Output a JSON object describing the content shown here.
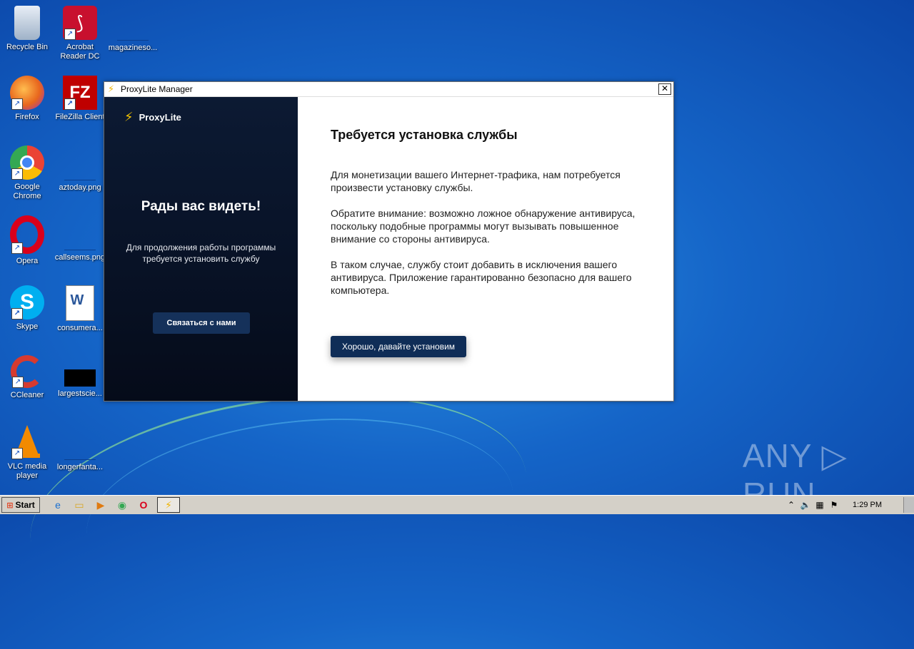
{
  "desktop": {
    "icons": [
      {
        "label": "Recycle Bin",
        "glyph": "🗑",
        "color": "#cfd8e8"
      },
      {
        "label": "Acrobat Reader DC",
        "glyph": "A",
        "color": "#c8102e"
      },
      {
        "label": "magazineso...",
        "glyph": "",
        "color": "#0a4fb0"
      },
      {
        "label": "Firefox",
        "glyph": "🦊",
        "color": "#e8661d"
      },
      {
        "label": "FileZilla Client",
        "glyph": "FZ",
        "color": "#bf0000"
      },
      {
        "label": "Google Chrome",
        "glyph": "◉",
        "color": "#34a853"
      },
      {
        "label": "aztoday.png",
        "glyph": "",
        "color": "#0a4fb0"
      },
      {
        "label": "Opera",
        "glyph": "O",
        "color": "#d9001b"
      },
      {
        "label": "callseems.png",
        "glyph": "",
        "color": "#0a4fb0"
      },
      {
        "label": "Skype",
        "glyph": "S",
        "color": "#00aff0"
      },
      {
        "label": "consumera...",
        "glyph": "W",
        "color": "#2b579a"
      },
      {
        "label": "CCleaner",
        "glyph": "C",
        "color": "#d63a2f"
      },
      {
        "label": "largestscie...",
        "glyph": "",
        "color": "#000000"
      },
      {
        "label": "VLC media player",
        "glyph": "▲",
        "color": "#f28a00"
      },
      {
        "label": "longerfanta...",
        "glyph": "",
        "color": "#0a4fb0"
      }
    ]
  },
  "window": {
    "title": "ProxyLite Manager",
    "close_glyph": "✕",
    "left_panel": {
      "logo_text": "ProxyLite",
      "welcome": "Рады вас видеть!",
      "subtext": "Для продолжения работы программы требуется установить службу",
      "contact_button": "Связаться с нами"
    },
    "right_panel": {
      "title": "Требуется установка службы",
      "paragraph1": "Для монетизации вашего Интернет-трафика, нам потребуется произвести установку службы.",
      "paragraph2": "Обратите внимание: возможно ложное обнаружение антивируса, поскольку подобные программы могут вызывать повышенное внимание со стороны антивируса.",
      "paragraph3": "В таком случае, службу стоит добавить в исключения вашего антивируса. Приложение гарантированно безопасно для вашего компьютера.",
      "ok_button": "Хорошо, давайте установим"
    }
  },
  "watermark": "ANY ▷ RUN",
  "taskbar": {
    "start_label": "Start",
    "clock": "1:29 PM"
  },
  "colors": {
    "accent_bolt": "#f5c400",
    "left_panel_bg": "#0a1630",
    "button_bg": "#0f2d57"
  }
}
